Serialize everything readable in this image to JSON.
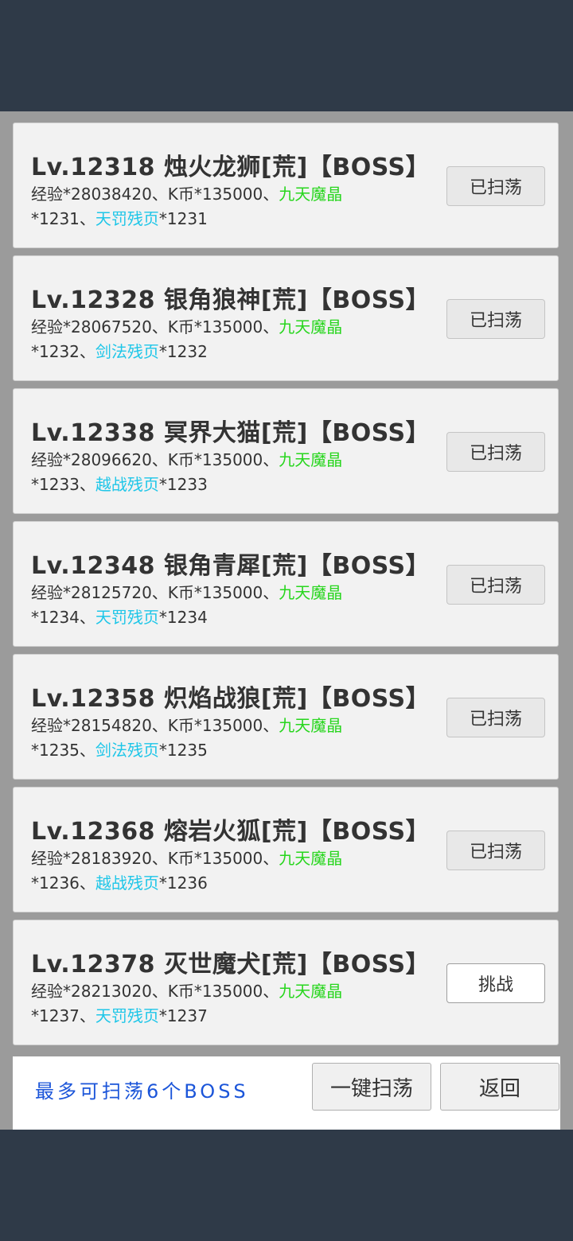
{
  "status_partial_text": "",
  "cards": [
    {
      "title": "Lv.12318 烛火龙狮[荒]【BOSS】",
      "exp": "经验*28038420、K币*135000、",
      "item1": "九天魔晶",
      "qty1": "*1231、",
      "item2": "天罚残页",
      "qty2": "*1231",
      "button": "已扫荡"
    },
    {
      "title": "Lv.12328 银角狼神[荒]【BOSS】",
      "exp": "经验*28067520、K币*135000、",
      "item1": "九天魔晶",
      "qty1": "*1232、",
      "item2": "剑法残页",
      "qty2": "*1232",
      "button": "已扫荡"
    },
    {
      "title": "Lv.12338 冥界大猫[荒]【BOSS】",
      "exp": "经验*28096620、K币*135000、",
      "item1": "九天魔晶",
      "qty1": "*1233、",
      "item2": "越战残页",
      "qty2": "*1233",
      "button": "已扫荡"
    },
    {
      "title": "Lv.12348 银角青犀[荒]【BOSS】",
      "exp": "经验*28125720、K币*135000、",
      "item1": "九天魔晶",
      "qty1": "*1234、",
      "item2": "天罚残页",
      "qty2": "*1234",
      "button": "已扫荡"
    },
    {
      "title": "Lv.12358 炽焰战狼[荒]【BOSS】",
      "exp": "经验*28154820、K币*135000、",
      "item1": "九天魔晶",
      "qty1": "*1235、",
      "item2": "剑法残页",
      "qty2": "*1235",
      "button": "已扫荡"
    },
    {
      "title": "Lv.12368 熔岩火狐[荒]【BOSS】",
      "exp": "经验*28183920、K币*135000、",
      "item1": "九天魔晶",
      "qty1": "*1236、",
      "item2": "越战残页",
      "qty2": "*1236",
      "button": "已扫荡"
    },
    {
      "title": "Lv.12378 灭世魔犬[荒]【BOSS】",
      "exp": "经验*28213020、K币*135000、",
      "item1": "九天魔晶",
      "qty1": "*1237、",
      "item2": "天罚残页",
      "qty2": "*1237",
      "button": "挑战"
    }
  ],
  "bottom": {
    "limit_text": "最多可扫荡6个BOSS",
    "sweep_all": "一键扫荡",
    "back": "返回"
  },
  "colors": {
    "background": "#2f3a48",
    "panel": "#9b9b9b",
    "item_green": "#28d61e",
    "item_cyan": "#1ec6e8",
    "limit_text": "#1b55d9"
  }
}
